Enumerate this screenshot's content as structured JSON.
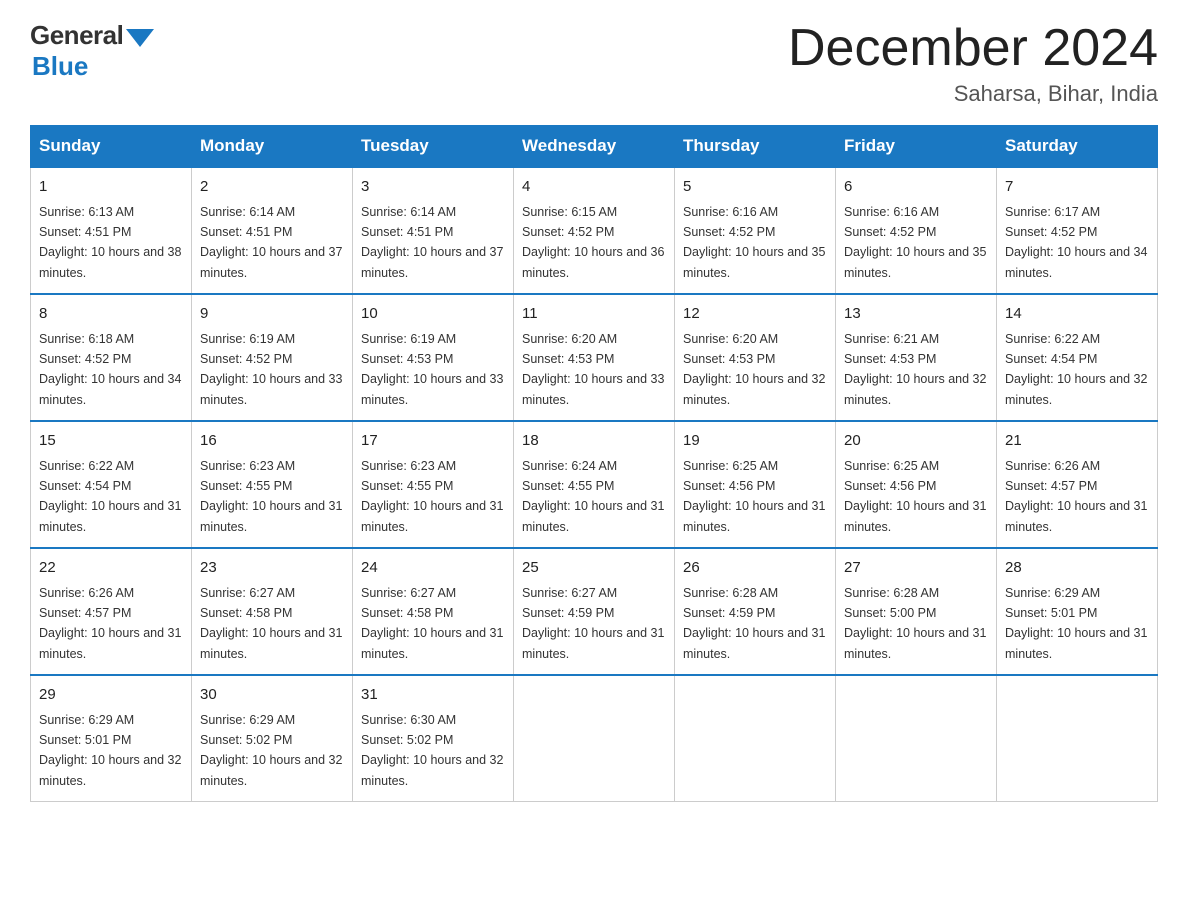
{
  "logo": {
    "general_text": "General",
    "blue_text": "Blue"
  },
  "title": "December 2024",
  "subtitle": "Saharsa, Bihar, India",
  "headers": [
    "Sunday",
    "Monday",
    "Tuesday",
    "Wednesday",
    "Thursday",
    "Friday",
    "Saturday"
  ],
  "weeks": [
    [
      {
        "day": "1",
        "sunrise": "6:13 AM",
        "sunset": "4:51 PM",
        "daylight": "10 hours and 38 minutes."
      },
      {
        "day": "2",
        "sunrise": "6:14 AM",
        "sunset": "4:51 PM",
        "daylight": "10 hours and 37 minutes."
      },
      {
        "day": "3",
        "sunrise": "6:14 AM",
        "sunset": "4:51 PM",
        "daylight": "10 hours and 37 minutes."
      },
      {
        "day": "4",
        "sunrise": "6:15 AM",
        "sunset": "4:52 PM",
        "daylight": "10 hours and 36 minutes."
      },
      {
        "day": "5",
        "sunrise": "6:16 AM",
        "sunset": "4:52 PM",
        "daylight": "10 hours and 35 minutes."
      },
      {
        "day": "6",
        "sunrise": "6:16 AM",
        "sunset": "4:52 PM",
        "daylight": "10 hours and 35 minutes."
      },
      {
        "day": "7",
        "sunrise": "6:17 AM",
        "sunset": "4:52 PM",
        "daylight": "10 hours and 34 minutes."
      }
    ],
    [
      {
        "day": "8",
        "sunrise": "6:18 AM",
        "sunset": "4:52 PM",
        "daylight": "10 hours and 34 minutes."
      },
      {
        "day": "9",
        "sunrise": "6:19 AM",
        "sunset": "4:52 PM",
        "daylight": "10 hours and 33 minutes."
      },
      {
        "day": "10",
        "sunrise": "6:19 AM",
        "sunset": "4:53 PM",
        "daylight": "10 hours and 33 minutes."
      },
      {
        "day": "11",
        "sunrise": "6:20 AM",
        "sunset": "4:53 PM",
        "daylight": "10 hours and 33 minutes."
      },
      {
        "day": "12",
        "sunrise": "6:20 AM",
        "sunset": "4:53 PM",
        "daylight": "10 hours and 32 minutes."
      },
      {
        "day": "13",
        "sunrise": "6:21 AM",
        "sunset": "4:53 PM",
        "daylight": "10 hours and 32 minutes."
      },
      {
        "day": "14",
        "sunrise": "6:22 AM",
        "sunset": "4:54 PM",
        "daylight": "10 hours and 32 minutes."
      }
    ],
    [
      {
        "day": "15",
        "sunrise": "6:22 AM",
        "sunset": "4:54 PM",
        "daylight": "10 hours and 31 minutes."
      },
      {
        "day": "16",
        "sunrise": "6:23 AM",
        "sunset": "4:55 PM",
        "daylight": "10 hours and 31 minutes."
      },
      {
        "day": "17",
        "sunrise": "6:23 AM",
        "sunset": "4:55 PM",
        "daylight": "10 hours and 31 minutes."
      },
      {
        "day": "18",
        "sunrise": "6:24 AM",
        "sunset": "4:55 PM",
        "daylight": "10 hours and 31 minutes."
      },
      {
        "day": "19",
        "sunrise": "6:25 AM",
        "sunset": "4:56 PM",
        "daylight": "10 hours and 31 minutes."
      },
      {
        "day": "20",
        "sunrise": "6:25 AM",
        "sunset": "4:56 PM",
        "daylight": "10 hours and 31 minutes."
      },
      {
        "day": "21",
        "sunrise": "6:26 AM",
        "sunset": "4:57 PM",
        "daylight": "10 hours and 31 minutes."
      }
    ],
    [
      {
        "day": "22",
        "sunrise": "6:26 AM",
        "sunset": "4:57 PM",
        "daylight": "10 hours and 31 minutes."
      },
      {
        "day": "23",
        "sunrise": "6:27 AM",
        "sunset": "4:58 PM",
        "daylight": "10 hours and 31 minutes."
      },
      {
        "day": "24",
        "sunrise": "6:27 AM",
        "sunset": "4:58 PM",
        "daylight": "10 hours and 31 minutes."
      },
      {
        "day": "25",
        "sunrise": "6:27 AM",
        "sunset": "4:59 PM",
        "daylight": "10 hours and 31 minutes."
      },
      {
        "day": "26",
        "sunrise": "6:28 AM",
        "sunset": "4:59 PM",
        "daylight": "10 hours and 31 minutes."
      },
      {
        "day": "27",
        "sunrise": "6:28 AM",
        "sunset": "5:00 PM",
        "daylight": "10 hours and 31 minutes."
      },
      {
        "day": "28",
        "sunrise": "6:29 AM",
        "sunset": "5:01 PM",
        "daylight": "10 hours and 31 minutes."
      }
    ],
    [
      {
        "day": "29",
        "sunrise": "6:29 AM",
        "sunset": "5:01 PM",
        "daylight": "10 hours and 32 minutes."
      },
      {
        "day": "30",
        "sunrise": "6:29 AM",
        "sunset": "5:02 PM",
        "daylight": "10 hours and 32 minutes."
      },
      {
        "day": "31",
        "sunrise": "6:30 AM",
        "sunset": "5:02 PM",
        "daylight": "10 hours and 32 minutes."
      },
      null,
      null,
      null,
      null
    ]
  ]
}
